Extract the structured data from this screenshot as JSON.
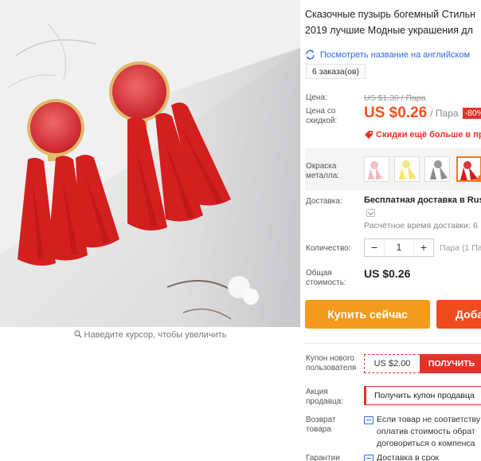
{
  "gallery": {
    "zoom_hint": "Наведите курсор, чтобы увеличить"
  },
  "product": {
    "title_line1": "Сказочные пузырь богемный Стильн",
    "title_line2": "2019 лучшие Модные украшения дл",
    "translate_link": "Посмотреть название на английском",
    "orders": "6 заказа(ов)"
  },
  "price": {
    "label": "Цена:",
    "old": "US $1.30",
    "old_unit": " / Пара",
    "discount_label_1": "Цена со",
    "discount_label_2": "скидкой:",
    "new": "US $0.26",
    "unit": "/ Пара",
    "badge": "-80%",
    "more_discounts": "Скидки ещё больше в при"
  },
  "color": {
    "label_1": "Окраска",
    "label_2": "металла:",
    "options": [
      "pink",
      "yellow",
      "gray",
      "red"
    ],
    "selected": 3,
    "accent": "#f47a1a"
  },
  "shipping": {
    "label": "Доставка:",
    "value": "Бесплатная доставка в Russ",
    "estimate": "Расчётное время доставки: 6"
  },
  "quantity": {
    "label": "Количество:",
    "minus": "−",
    "value": "1",
    "plus": "+",
    "unit": "Пара (1 Па"
  },
  "total": {
    "label_1": "Общая",
    "label_2": "стоимость:",
    "value": "US $0.26"
  },
  "actions": {
    "buy": "Купить сейчас",
    "cart": "Доба"
  },
  "promos": {
    "new_user_label_1": "Купон нового",
    "new_user_label_2": "пользователя",
    "coupon_amount": "US $2.00",
    "coupon_get": "ПОЛУЧИТЬ",
    "seller_label_1": "Акция",
    "seller_label_2": "продавца:",
    "seller_coupon": "Получить купон продавца",
    "return_label_1": "Возврат",
    "return_label_2": "товара",
    "return_line1": "Если товар не соответству",
    "return_line2": "оплатив стоимость обрат",
    "return_line3": "договориться о компенса",
    "guarantee_label": "Гарантии",
    "guarantee_value": "Доставка в срок"
  },
  "colors": {
    "price": "#f4511e",
    "badge": "#e6322b",
    "buy": "#f59b1b",
    "cart": "#f04b1c",
    "link": "#2a6ed7"
  }
}
